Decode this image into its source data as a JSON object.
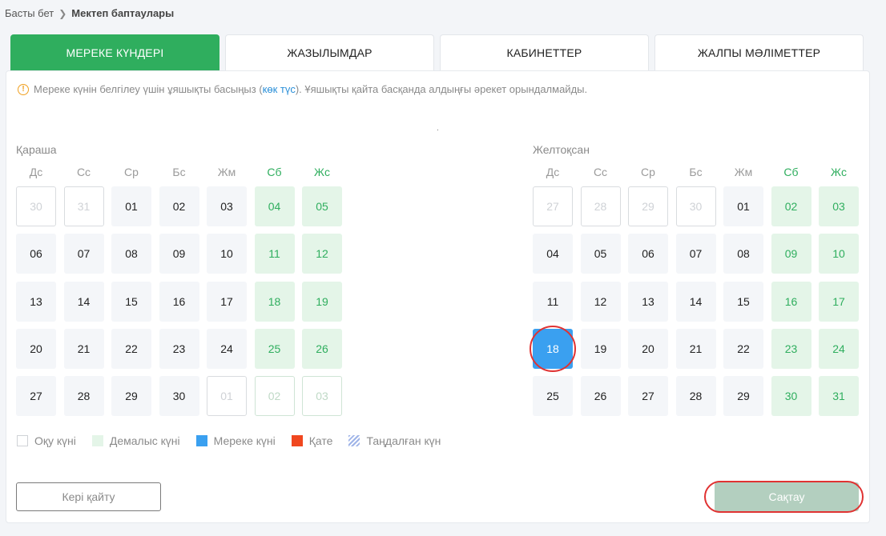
{
  "breadcrumb": {
    "home": "Басты бет",
    "current": "Мектеп баптаулары"
  },
  "tabs": [
    {
      "label": "МЕРЕКЕ КҮНДЕРІ",
      "active": true
    },
    {
      "label": "ЖАЗЫЛЫМДАР",
      "active": false
    },
    {
      "label": "КАБИНЕТТЕР",
      "active": false
    },
    {
      "label": "ЖАЛПЫ МӘЛІМЕТТЕР",
      "active": false
    }
  ],
  "info": {
    "before": "Мереке күнін белгілеу үшін ұяшықты басыңыз (",
    "highlight": "көк түс",
    "after": "). Ұяшықты қайта басқанда алдыңғы әрекет орындалмайды."
  },
  "weekdays": [
    "Дс",
    "Сс",
    "Ср",
    "Бс",
    "Жм",
    "Сб",
    "Жс"
  ],
  "months": [
    {
      "name": "Қараша",
      "days": [
        {
          "d": "30",
          "other": true
        },
        {
          "d": "31",
          "other": true
        },
        {
          "d": "01"
        },
        {
          "d": "02"
        },
        {
          "d": "03"
        },
        {
          "d": "04",
          "weekend": true
        },
        {
          "d": "05",
          "weekend": true
        },
        {
          "d": "06"
        },
        {
          "d": "07"
        },
        {
          "d": "08"
        },
        {
          "d": "09"
        },
        {
          "d": "10"
        },
        {
          "d": "11",
          "weekend": true
        },
        {
          "d": "12",
          "weekend": true
        },
        {
          "d": "13"
        },
        {
          "d": "14"
        },
        {
          "d": "15"
        },
        {
          "d": "16"
        },
        {
          "d": "17"
        },
        {
          "d": "18",
          "weekend": true
        },
        {
          "d": "19",
          "weekend": true
        },
        {
          "d": "20"
        },
        {
          "d": "21"
        },
        {
          "d": "22"
        },
        {
          "d": "23"
        },
        {
          "d": "24"
        },
        {
          "d": "25",
          "weekend": true
        },
        {
          "d": "26",
          "weekend": true
        },
        {
          "d": "27"
        },
        {
          "d": "28"
        },
        {
          "d": "29"
        },
        {
          "d": "30"
        },
        {
          "d": "01",
          "other": true
        },
        {
          "d": "02",
          "other": true,
          "weekend": true
        },
        {
          "d": "03",
          "other": true,
          "weekend": true
        }
      ]
    },
    {
      "name": "Желтоқсан",
      "days": [
        {
          "d": "27",
          "other": true
        },
        {
          "d": "28",
          "other": true
        },
        {
          "d": "29",
          "other": true
        },
        {
          "d": "30",
          "other": true
        },
        {
          "d": "01"
        },
        {
          "d": "02",
          "weekend": true
        },
        {
          "d": "03",
          "weekend": true
        },
        {
          "d": "04"
        },
        {
          "d": "05"
        },
        {
          "d": "06"
        },
        {
          "d": "07"
        },
        {
          "d": "08"
        },
        {
          "d": "09",
          "weekend": true
        },
        {
          "d": "10",
          "weekend": true
        },
        {
          "d": "11"
        },
        {
          "d": "12"
        },
        {
          "d": "13"
        },
        {
          "d": "14"
        },
        {
          "d": "15"
        },
        {
          "d": "16",
          "weekend": true
        },
        {
          "d": "17",
          "weekend": true
        },
        {
          "d": "18",
          "holiday": true
        },
        {
          "d": "19"
        },
        {
          "d": "20"
        },
        {
          "d": "21"
        },
        {
          "d": "22"
        },
        {
          "d": "23",
          "weekend": true
        },
        {
          "d": "24",
          "weekend": true
        },
        {
          "d": "25"
        },
        {
          "d": "26"
        },
        {
          "d": "27"
        },
        {
          "d": "28"
        },
        {
          "d": "29"
        },
        {
          "d": "30",
          "weekend": true
        },
        {
          "d": "31",
          "weekend": true
        }
      ]
    }
  ],
  "legend": {
    "study": "Оқу күні",
    "rest": "Демалыс күні",
    "holiday": "Мереке күні",
    "error": "Қате",
    "selected": "Таңдалған күн"
  },
  "buttons": {
    "back": "Кері қайту",
    "save": "Сақтау"
  },
  "colors": {
    "accent": "#2fae5e",
    "holiday": "#3aa0f0",
    "error": "#f0471f"
  }
}
